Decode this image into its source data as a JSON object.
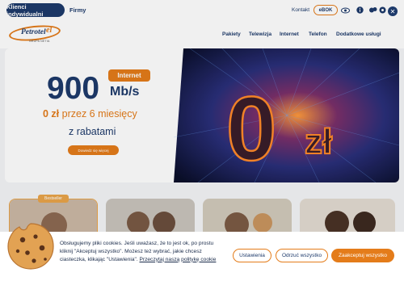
{
  "topbar": {
    "segments": [
      "Klienci indywidualni",
      "Firmy"
    ],
    "kontakt": "Kontakt",
    "ebok": "eBOK",
    "icons": [
      "eye-icon",
      "info-icon",
      "accessibility-icon",
      "globe-icon",
      "close-icon"
    ]
  },
  "header": {
    "logo_name": "Petrotel",
    "logo_el": "el",
    "logo_sub": "GRUPA NETIA",
    "nav": [
      "Pakiety",
      "Telewizja",
      "Internet",
      "Telefon",
      "Dodatkowe usługi"
    ]
  },
  "hero": {
    "speed": "900",
    "badge": "Internet",
    "unit": "Mb/s",
    "promo_bold": "0 zł",
    "promo_rest": " przez 6 miesięcy",
    "promo_line2": "z rabatami",
    "cta": "Dowiedz się więcej",
    "art_big": "0",
    "art_small": "zł"
  },
  "cards": {
    "badge": "Bestseller"
  },
  "cookie": {
    "text_1": "Obsługujemy pliki cookies. Jeśli uważasz, że to jest ok, po prostu kliknij \"Akceptuj wszystko\". Możesz też wybrać, jakie chcesz ciasteczka, klikając \"Ustawienia\". ",
    "link": "Przeczytaj naszą politykę cookie",
    "btn_settings": "Ustawienia",
    "btn_reject": "Odrzuć wszystko",
    "btn_accept": "Zaakceptuj wszystko"
  },
  "colors": {
    "navy": "#1d3a6b",
    "orange": "#e47c1a"
  }
}
